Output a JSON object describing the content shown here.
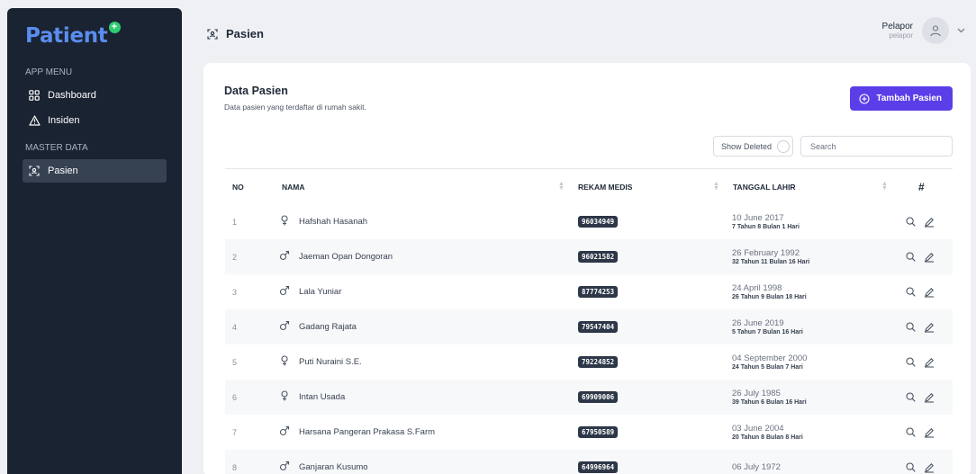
{
  "sidebar": {
    "brand": "Patient",
    "sections": [
      {
        "title": "APP MENU",
        "items": [
          {
            "label": "Dashboard",
            "icon": "grid-icon"
          },
          {
            "label": "Insiden",
            "icon": "warning-icon"
          }
        ]
      },
      {
        "title": "MASTER DATA",
        "items": [
          {
            "label": "Pasien",
            "icon": "scan-icon",
            "active": true
          }
        ]
      }
    ]
  },
  "header": {
    "title": "Pasien",
    "user_name": "Pelapor",
    "user_role": "pelapor"
  },
  "card": {
    "title": "Data Pasien",
    "subtitle": "Data pasien yang terdaftar di rumah sakit.",
    "add_button": "Tambah Pasien",
    "show_deleted": "Show Deleted",
    "search_placeholder": "Search"
  },
  "table": {
    "columns": [
      "NO",
      "NAMA",
      "REKAM MEDIS",
      "TANGGAL LAHIR",
      "#"
    ],
    "rows": [
      {
        "no": "1",
        "gender": "female",
        "name": "Hafshah Hasanah",
        "rm": "96034949",
        "date": "10 June 2017",
        "age": "7 Tahun 8 Bulan 1 Hari"
      },
      {
        "no": "2",
        "gender": "male",
        "name": "Jaeman Opan Dongoran",
        "rm": "96021582",
        "date": "26 February 1992",
        "age": "32 Tahun 11 Bulan 16 Hari"
      },
      {
        "no": "3",
        "gender": "male",
        "name": "Lala Yuniar",
        "rm": "87774253",
        "date": "24 April 1998",
        "age": "26 Tahun 9 Bulan 18 Hari"
      },
      {
        "no": "4",
        "gender": "male",
        "name": "Gadang Rajata",
        "rm": "79547404",
        "date": "26 June 2019",
        "age": "5 Tahun 7 Bulan 16 Hari"
      },
      {
        "no": "5",
        "gender": "female",
        "name": "Puti Nuraini S.E.",
        "rm": "79224852",
        "date": "04 September 2000",
        "age": "24 Tahun 5 Bulan 7 Hari"
      },
      {
        "no": "6",
        "gender": "female",
        "name": "Intan Usada",
        "rm": "69909006",
        "date": "26 July 1985",
        "age": "39 Tahun 6 Bulan 16 Hari"
      },
      {
        "no": "7",
        "gender": "male",
        "name": "Harsana Pangeran Prakasa S.Farm",
        "rm": "67950589",
        "date": "03 June 2004",
        "age": "20 Tahun 8 Bulan 8 Hari"
      },
      {
        "no": "8",
        "gender": "male",
        "name": "Ganjaran Kusumo",
        "rm": "64996964",
        "date": "06 July 1972",
        "age": ""
      }
    ]
  },
  "colors": {
    "sidebar_bg": "#1a2332",
    "brand": "#5a8dee",
    "accent": "#5b3ee8",
    "badge_bg": "#2d3748"
  }
}
